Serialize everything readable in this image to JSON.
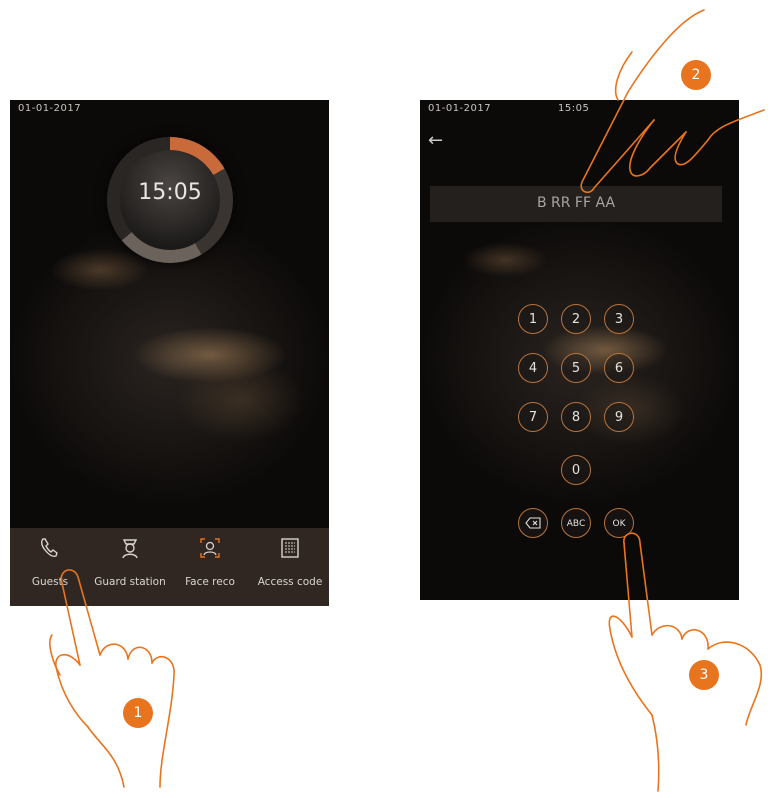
{
  "left_screen": {
    "date": "01-01-2017",
    "clock_time": "15:05",
    "nav": [
      {
        "label": "Guests",
        "icon": "phone-icon"
      },
      {
        "label": "Guard station",
        "icon": "guard-icon"
      },
      {
        "label": "Face reco",
        "icon": "face-recognition-icon"
      },
      {
        "label": "Access code",
        "icon": "keypad-icon"
      }
    ]
  },
  "right_screen": {
    "date": "01-01-2017",
    "time": "15:05",
    "code_value": "B RR FF AA",
    "keys": {
      "k1": "1",
      "k2": "2",
      "k3": "3",
      "k4": "4",
      "k5": "5",
      "k6": "6",
      "k7": "7",
      "k8": "8",
      "k9": "9",
      "k0": "0",
      "abc": "ABC",
      "ok": "OK"
    }
  },
  "steps": {
    "one": "1",
    "two": "2",
    "three": "3"
  },
  "colors": {
    "accent": "#e8741e",
    "key_border": "#b8733d"
  }
}
